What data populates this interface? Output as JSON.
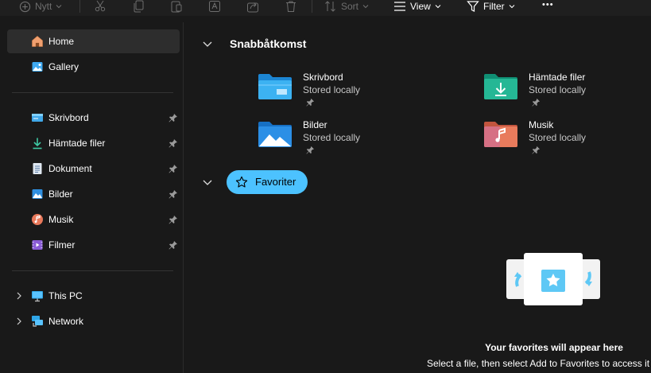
{
  "toolbar": {
    "new_label": "Nytt",
    "sort_label": "Sort",
    "view_label": "View",
    "filter_label": "Filter",
    "more_label": "•••"
  },
  "sidebar": {
    "top_items": [
      {
        "label": "Home",
        "icon": "home-icon"
      },
      {
        "label": "Gallery",
        "icon": "gallery-icon"
      }
    ],
    "pinned_items": [
      {
        "label": "Skrivbord",
        "icon": "desktop-folder-icon"
      },
      {
        "label": "Hämtade filer",
        "icon": "download-icon"
      },
      {
        "label": "Dokument",
        "icon": "document-icon"
      },
      {
        "label": "Bilder",
        "icon": "pictures-icon"
      },
      {
        "label": "Musik",
        "icon": "music-icon"
      },
      {
        "label": "Filmer",
        "icon": "video-icon"
      }
    ],
    "tree_items": [
      {
        "label": "This PC",
        "icon": "this-pc-icon"
      },
      {
        "label": "Network",
        "icon": "network-icon"
      }
    ]
  },
  "quick_access": {
    "title": "Snabbåtkomst",
    "items": [
      {
        "name": "Skrivbord",
        "status": "Stored locally",
        "icon": "desktop-folder-icon"
      },
      {
        "name": "Hämtade filer",
        "status": "Stored locally",
        "icon": "downloads-folder-icon"
      },
      {
        "name": "Bilder",
        "status": "Stored locally",
        "icon": "pictures-folder-icon"
      },
      {
        "name": "Musik",
        "status": "Stored locally",
        "icon": "music-folder-icon"
      }
    ]
  },
  "favorites": {
    "title": "Favoriter",
    "empty_title": "Your favorites will appear here",
    "empty_subtitle": "Select a file, then select Add to Favorites to access it"
  },
  "colors": {
    "accent": "#4cc2ff",
    "background": "#191919",
    "selected": "#2d2d2d"
  }
}
